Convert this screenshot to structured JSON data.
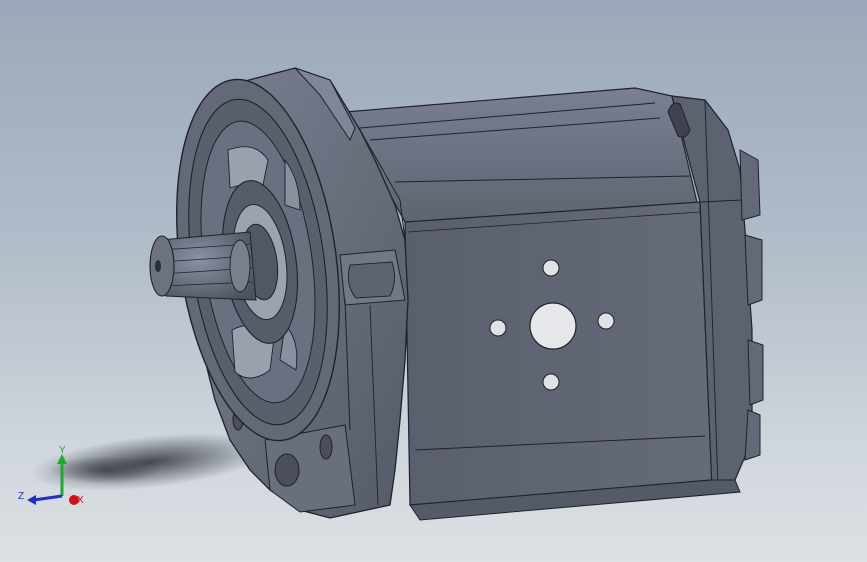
{
  "view": {
    "background_top": "#9aa8b9",
    "background_bottom": "#dde1e5",
    "part_color": "#6c7180"
  },
  "triad": {
    "x_label": "X",
    "y_label": "Y",
    "z_label": "Z",
    "x_color": "#d4111b",
    "y_color": "#22a832",
    "z_color": "#1b2fc9"
  }
}
